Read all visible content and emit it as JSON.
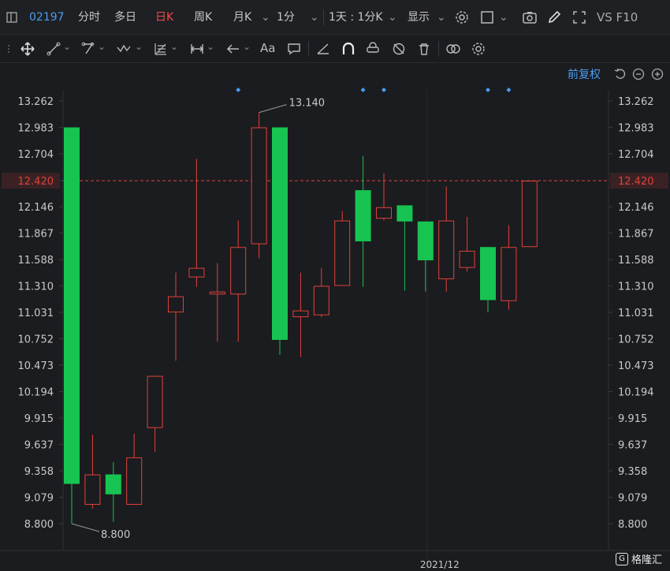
{
  "topbar": {
    "symbol": "02197",
    "items": [
      "分时",
      "多日",
      "日K",
      "周K",
      "月K",
      "1分",
      "1天 : 1分K",
      "显示"
    ],
    "active": "日K",
    "right_text": "VS  F10"
  },
  "chart": {
    "restore_label": "前复权",
    "y_ticks": [
      "13.262",
      "12.983",
      "12.704",
      "12.420",
      "12.146",
      "11.867",
      "11.588",
      "11.310",
      "11.031",
      "10.752",
      "10.473",
      "10.194",
      "9.915",
      "9.637",
      "9.358",
      "9.079",
      "8.800"
    ],
    "current_price": "12.420",
    "high_label": "13.140",
    "low_label": "8.800",
    "x_label": "2021/12",
    "colors": {
      "up": "#e0413b",
      "down": "#17c451",
      "current": "#e0413b",
      "marker": "#4a9cf0"
    }
  },
  "watermark": {
    "text": "格隆汇",
    "logo": "G"
  },
  "chart_data": {
    "type": "candlestick",
    "ylim": [
      8.8,
      13.262
    ],
    "x_tick": "2021/12",
    "candles": [
      {
        "o": 12.983,
        "c": 9.22,
        "h": 12.983,
        "l": 8.8
      },
      {
        "o": 9.0,
        "c": 9.32,
        "h": 9.74,
        "l": 8.96
      },
      {
        "o": 9.32,
        "c": 9.11,
        "h": 9.45,
        "l": 8.82
      },
      {
        "o": 9.0,
        "c": 9.5,
        "h": 9.75,
        "l": 9.0
      },
      {
        "o": 9.81,
        "c": 10.36,
        "h": 10.36,
        "l": 9.56
      },
      {
        "o": 11.03,
        "c": 11.2,
        "h": 11.45,
        "l": 10.52
      },
      {
        "o": 11.4,
        "c": 11.5,
        "h": 12.65,
        "l": 11.3
      },
      {
        "o": 11.22,
        "c": 11.25,
        "h": 11.55,
        "l": 10.72
      },
      {
        "o": 11.22,
        "c": 11.72,
        "h": 12.0,
        "l": 10.72
      },
      {
        "o": 11.75,
        "c": 12.983,
        "h": 13.14,
        "l": 11.6
      },
      {
        "o": 12.983,
        "c": 10.74,
        "h": 12.983,
        "l": 10.58
      },
      {
        "o": 10.98,
        "c": 11.05,
        "h": 11.45,
        "l": 10.56
      },
      {
        "o": 11.0,
        "c": 11.31,
        "h": 11.5,
        "l": 10.98
      },
      {
        "o": 11.31,
        "c": 12.0,
        "h": 12.1,
        "l": 11.31
      },
      {
        "o": 12.32,
        "c": 11.78,
        "h": 12.68,
        "l": 11.3
      },
      {
        "o": 12.02,
        "c": 12.14,
        "h": 12.5,
        "l": 12.0
      },
      {
        "o": 12.16,
        "c": 11.99,
        "h": 12.16,
        "l": 11.26
      },
      {
        "o": 11.99,
        "c": 11.58,
        "h": 11.99,
        "l": 11.25
      },
      {
        "o": 11.38,
        "c": 12.0,
        "h": 12.36,
        "l": 11.25
      },
      {
        "o": 11.5,
        "c": 11.68,
        "h": 12.04,
        "l": 11.46
      },
      {
        "o": 11.72,
        "c": 11.16,
        "h": 11.72,
        "l": 11.03
      },
      {
        "o": 11.15,
        "c": 11.72,
        "h": 11.95,
        "l": 11.06
      },
      {
        "o": 11.72,
        "c": 12.42,
        "h": 12.42,
        "l": 11.72
      }
    ],
    "event_markers_at_candles": [
      8,
      14,
      15,
      20,
      21
    ]
  }
}
